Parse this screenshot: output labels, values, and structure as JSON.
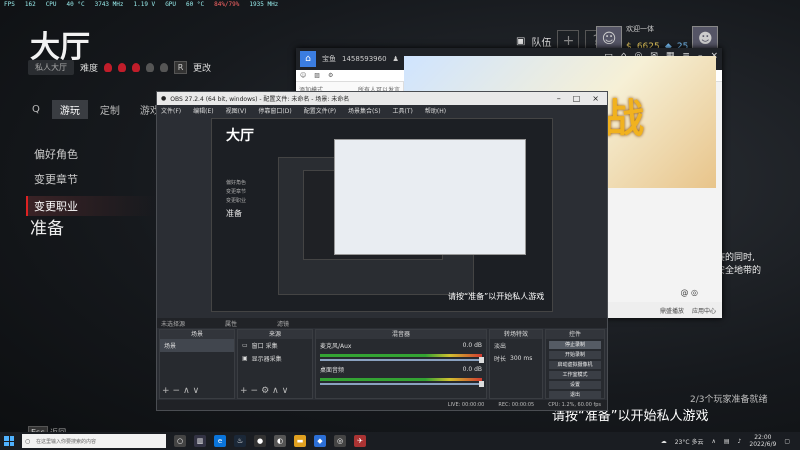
{
  "hud": {
    "fps_label": "FPS",
    "fps": "162",
    "cpu_label": "CPU",
    "cpu_temp": "40 °C",
    "cpu_clock": "3743 MHz",
    "cpu_volt": "1.19 V",
    "gpu_label": "GPU",
    "gpu_temp": "60 °C",
    "gpu_load": "84%/79%",
    "gpu_clock": "1935 MHz"
  },
  "game": {
    "title": "大厅",
    "private_lobby": "私人大厅",
    "difficulty": "难度",
    "change_key": "R",
    "change": "更改",
    "tabs": [
      "Q",
      "游玩",
      "定制",
      "游戏"
    ],
    "menu": [
      "偏好角色",
      "变更章节",
      "变更职业"
    ],
    "ready": "准备",
    "team": "队伍",
    "player_name": "欢迎一体",
    "gold": "6625",
    "gems": "25",
    "right_text_1": "赛的同时,",
    "right_text_2": "安全地带的",
    "players_ready": "2/3个玩家准备就绪",
    "ready_hint": "请按“准备”以开始私人游戏",
    "esc": "Esc",
    "back": "返回"
  },
  "chat": {
    "tab": "宝鱼",
    "room_id": "1458593960",
    "members": "3",
    "list_header": "添加模式",
    "list_header_right": "所有人可以发言",
    "input_hint": "@ ◎",
    "bottom_left": "鼎盛播放",
    "bottom_right": "应用中心",
    "banner_text": "战"
  },
  "obs": {
    "title": "OBS 27.2.4 (64 bit, windows) - 配置文件: 未命名 - 场景: 未命名",
    "menu": [
      "文件(F)",
      "编辑(E)",
      "视图(V)",
      "停靠窗口(D)",
      "配置文件(P)",
      "场景集合(S)",
      "工具(T)",
      "帮助(H)"
    ],
    "nested_title": "大厅",
    "nested_menu": [
      "偏好角色",
      "变更章节",
      "变更职业"
    ],
    "nested_ready": "准备",
    "nested_hint": "请按“准备”以开始私人游戏",
    "no_source": "未选择源",
    "props": "属性",
    "filters": "滤镜",
    "scenes_head": "场景",
    "scene_item": "场景",
    "sources_head": "来源",
    "sources": [
      "窗口 采集",
      "显示器采集"
    ],
    "mixer_head": "混音器",
    "mixer_1": "麦克风/Aux",
    "mixer_1_db": "0.0 dB",
    "mixer_2": "桌面音频",
    "mixer_2_db": "0.0 dB",
    "transition_head": "转场特效",
    "transition": "淡出",
    "duration_label": "时长",
    "duration": "300 ms",
    "controls_head": "控件",
    "controls": [
      "停止录制",
      "开始录制",
      "启动虚拟摄像机",
      "工作室模式",
      "设置",
      "退出"
    ],
    "status_live": "LIVE: 00:00:00",
    "status_rec": "REC: 00:00:05",
    "status_cpu": "CPU: 1.2%, 60.00 fps"
  },
  "taskbar": {
    "search": "在这里输入你要搜索的内容",
    "weather": "23°C 多云",
    "time": "22:00",
    "date": "2022/6/9"
  }
}
